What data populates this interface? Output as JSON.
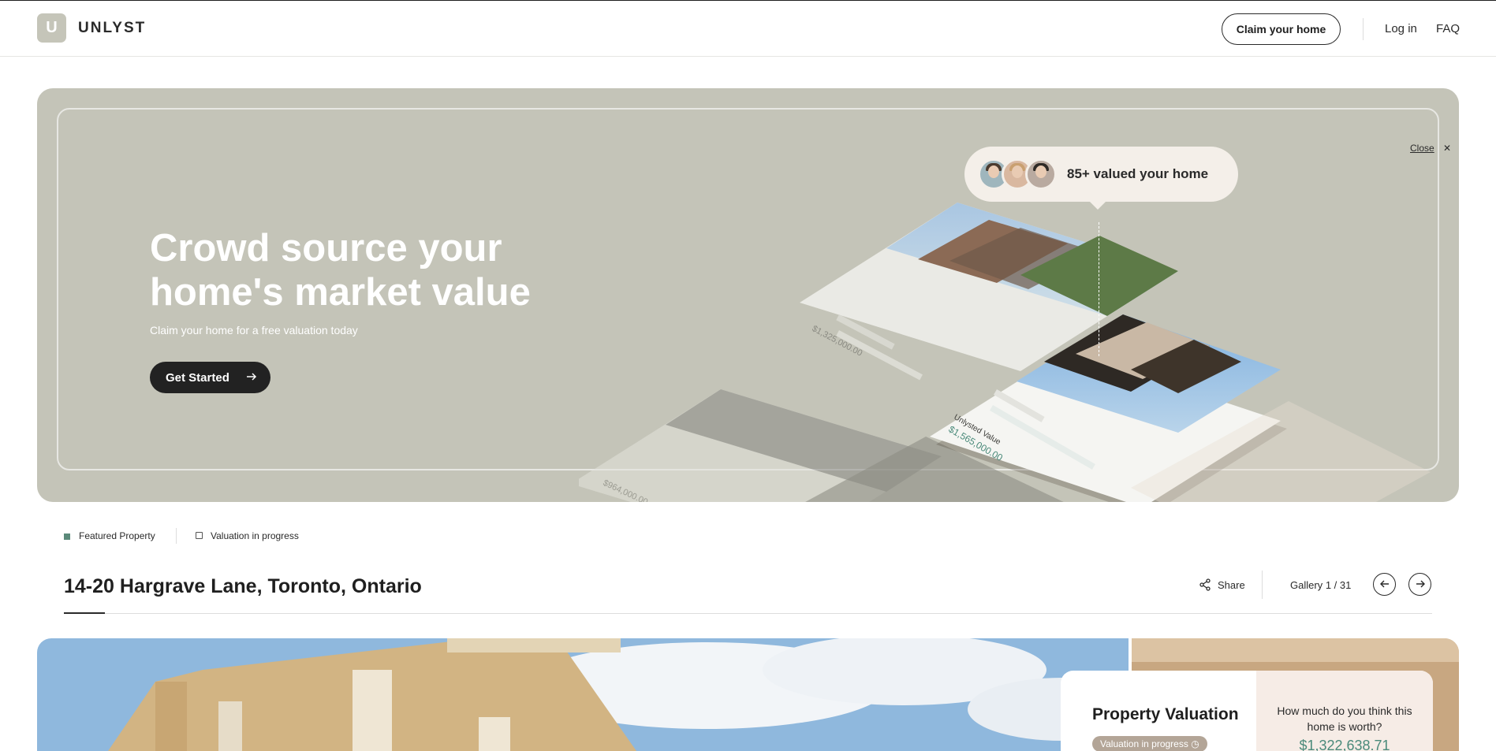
{
  "header": {
    "logo_letter": "U",
    "brand": "UNLYST",
    "claim_button": "Claim your home",
    "login": "Log in",
    "faq": "FAQ"
  },
  "hero": {
    "title": "Crowd source your home's market value",
    "subtitle": "Claim your home for a free valuation today",
    "cta": "Get Started",
    "close": "Close",
    "bubble_text": "85+ valued your home",
    "cards": [
      {
        "label": "Unlysted Value",
        "value": "$1,325,000.00"
      },
      {
        "label": "Unlysted Value",
        "value": "$1,565,000.00"
      },
      {
        "label": "Unlysted Value",
        "value": "$964,000.00"
      }
    ]
  },
  "property": {
    "tag_featured": "Featured Property",
    "tag_status": "Valuation in progress",
    "address": "14-20 Hargrave Lane, Toronto, Ontario",
    "share": "Share",
    "gallery": "Gallery",
    "gallery_pos": "1 / 31"
  },
  "valuation": {
    "title": "Property Valuation",
    "badge": "Valuation in progress",
    "question": "How much do you think this home is worth?",
    "amount": "$1,322,638.71"
  },
  "colors": {
    "hero_bg": "#c4c4b8",
    "accent_green": "#5b8a7a",
    "dark": "#222222"
  }
}
